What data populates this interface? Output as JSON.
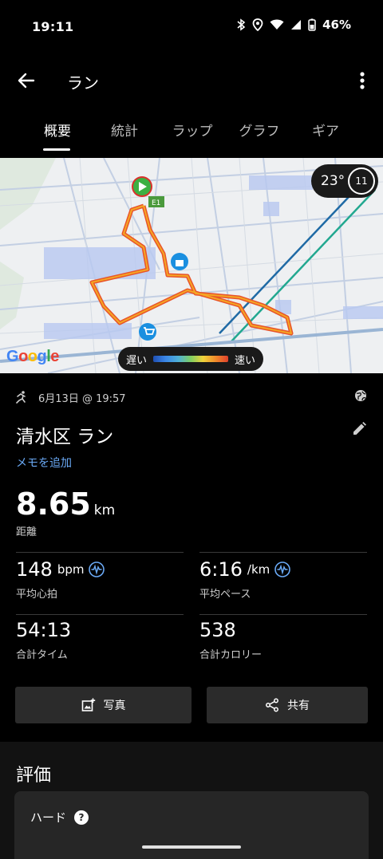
{
  "status_bar": {
    "time": "19:11",
    "battery": "46%"
  },
  "app_bar": {
    "title": "ラン"
  },
  "tabs": [
    {
      "label": "概要",
      "active": true
    },
    {
      "label": "統計",
      "active": false
    },
    {
      "label": "ラップ",
      "active": false
    },
    {
      "label": "グラフ",
      "active": false
    },
    {
      "label": "ギア",
      "active": false
    }
  ],
  "map": {
    "weather_temp": "23°",
    "moon_value": "11",
    "google_logo": "Google",
    "legend_slow": "遅い",
    "legend_fast": "速い",
    "route_marker_label": "E1"
  },
  "activity": {
    "date": "6月13日 @ 19:57",
    "title": "清水区 ラン",
    "add_memo": "メモを追加",
    "distance_value": "8.65",
    "distance_unit": "km",
    "distance_label": "距離"
  },
  "stats": {
    "heart_rate": {
      "value": "148",
      "unit": "bpm",
      "label": "平均心拍"
    },
    "pace": {
      "value": "6:16",
      "unit": "/km",
      "label": "平均ペース"
    },
    "time": {
      "value": "54:13",
      "label": "合計タイム"
    },
    "calories": {
      "value": "538",
      "label": "合計カロリー"
    }
  },
  "actions": {
    "photo": "写真",
    "share": "共有"
  },
  "rating": {
    "heading": "評価",
    "level": "ハード"
  },
  "colors": {
    "accent_blue": "#6aa9f5",
    "route_orange": "#f08a2b",
    "start_green": "#3cb043"
  }
}
